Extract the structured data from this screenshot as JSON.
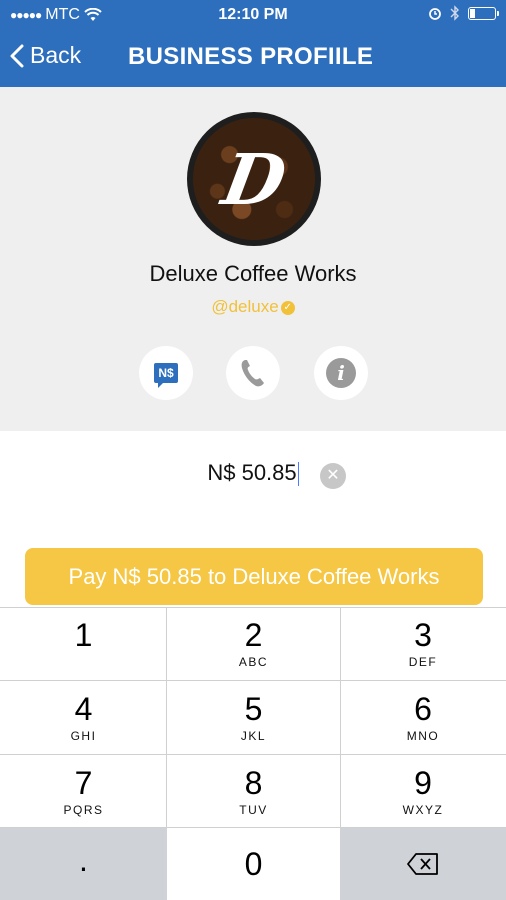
{
  "status_bar": {
    "carrier": "MTC",
    "time": "12:10 PM"
  },
  "nav": {
    "back_label": "Back",
    "title": "BUSINESS PROFIILE"
  },
  "profile": {
    "logo_letter": "D",
    "name": "Deluxe Coffee Works",
    "handle": "@deluxe"
  },
  "actions": {
    "pay_badge": "N$"
  },
  "amount": {
    "value": "N$ 50.85"
  },
  "pay_button": {
    "label": "Pay N$ 50.85 to Deluxe Coffee Works"
  },
  "keypad": {
    "keys": [
      {
        "num": "1",
        "letters": ""
      },
      {
        "num": "2",
        "letters": "ABC"
      },
      {
        "num": "3",
        "letters": "DEF"
      },
      {
        "num": "4",
        "letters": "GHI"
      },
      {
        "num": "5",
        "letters": "JKL"
      },
      {
        "num": "6",
        "letters": "MNO"
      },
      {
        "num": "7",
        "letters": "PQRS"
      },
      {
        "num": "8",
        "letters": "TUV"
      },
      {
        "num": "9",
        "letters": "WXYZ"
      },
      {
        "num": ".",
        "letters": ""
      },
      {
        "num": "0",
        "letters": ""
      }
    ]
  },
  "colors": {
    "nav_blue": "#2d6fbd",
    "accent_yellow": "#f6c744"
  }
}
